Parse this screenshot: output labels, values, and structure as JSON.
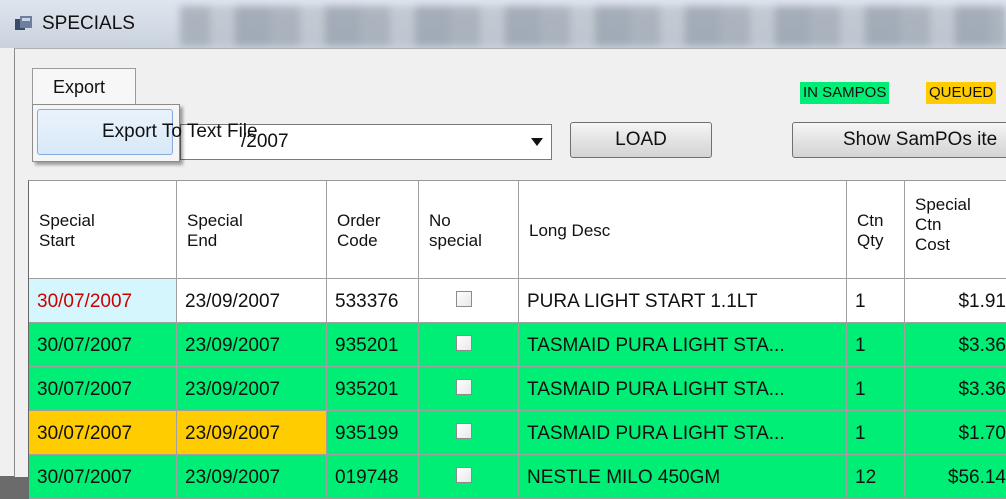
{
  "window": {
    "title": "SPECIALS"
  },
  "menu": {
    "tab_label": "Export",
    "items": [
      {
        "label": "Export To Text File"
      }
    ]
  },
  "toolbar": {
    "date_value": "/2007",
    "load_label": "LOAD",
    "show_label": "Show SamPOs ite"
  },
  "legend": {
    "in_sampos": "IN SAMPOS",
    "queued": "QUEUED"
  },
  "colors": {
    "in_sampos": "#00ee76",
    "queued": "#ffcc00",
    "selected_start": "#d6f6fd"
  },
  "grid": {
    "columns": [
      {
        "header": "Special\nStart"
      },
      {
        "header": "Special\nEnd"
      },
      {
        "header": "Order\nCode"
      },
      {
        "header": "No\nspecial"
      },
      {
        "header": "Long Desc"
      },
      {
        "header": "Ctn\nQty"
      },
      {
        "header": "Special\nCtn\nCost"
      }
    ],
    "rows": [
      {
        "start": "30/07/2007",
        "end": "23/09/2007",
        "code": "533376",
        "no_special": false,
        "desc": "PURA LIGHT START 1.1LT",
        "qty": "1",
        "cost": "$1.91",
        "status": "none"
      },
      {
        "start": "30/07/2007",
        "end": "23/09/2007",
        "code": "935201",
        "no_special": false,
        "desc": "TASMAID PURA LIGHT STA...",
        "qty": "1",
        "cost": "$3.36",
        "status": "in_sampos"
      },
      {
        "start": "30/07/2007",
        "end": "23/09/2007",
        "code": "935201",
        "no_special": false,
        "desc": "TASMAID PURA LIGHT STA...",
        "qty": "1",
        "cost": "$3.36",
        "status": "in_sampos"
      },
      {
        "start": "30/07/2007",
        "end": "23/09/2007",
        "code": "935199",
        "no_special": false,
        "desc": "TASMAID PURA LIGHT STA...",
        "qty": "1",
        "cost": "$1.70",
        "status": "queued_partial"
      },
      {
        "start": "30/07/2007",
        "end": "23/09/2007",
        "code": "019748",
        "no_special": false,
        "desc": "NESTLE MILO 450GM",
        "qty": "12",
        "cost": "$56.14",
        "status": "in_sampos"
      }
    ]
  }
}
